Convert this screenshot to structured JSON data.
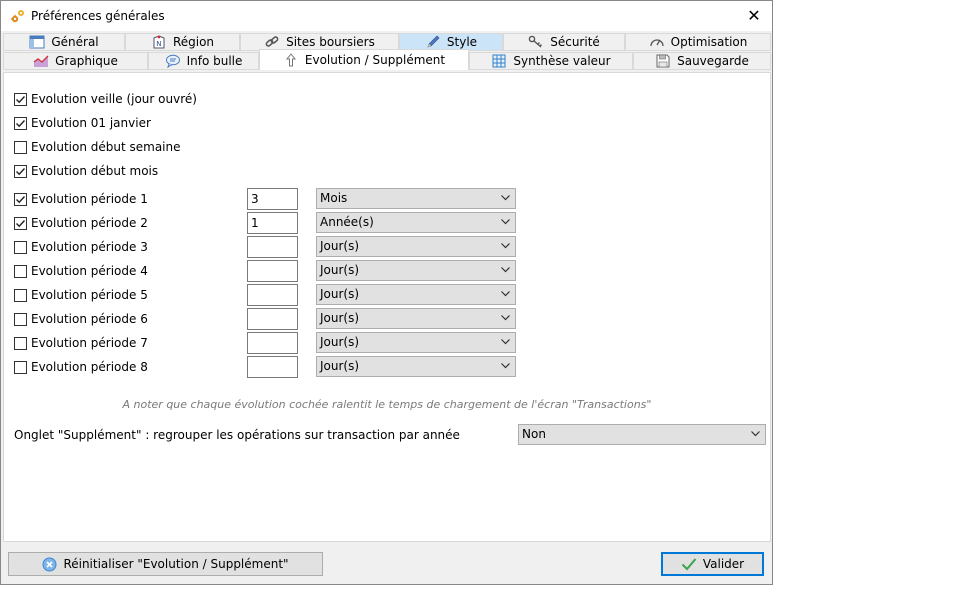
{
  "window": {
    "title": "Préférences générales",
    "close_label": "✕"
  },
  "tabs_row1": [
    {
      "label": "Général",
      "icon": "window-icon"
    },
    {
      "label": "Région",
      "icon": "region-icon"
    },
    {
      "label": "Sites boursiers",
      "icon": "link-icon"
    },
    {
      "label": "Style",
      "icon": "pencil-icon"
    },
    {
      "label": "Sécurité",
      "icon": "key-icon"
    },
    {
      "label": "Optimisation",
      "icon": "gauge-icon"
    }
  ],
  "tabs_row2": [
    {
      "label": "Graphique",
      "icon": "chart-icon"
    },
    {
      "label": "Info bulle",
      "icon": "speech-bubble-icon"
    },
    {
      "label": "Evolution / Supplément",
      "icon": "arrow-up-icon"
    },
    {
      "label": "Synthèse valeur",
      "icon": "grid-icon"
    },
    {
      "label": "Sauvegarde",
      "icon": "floppy-icon"
    }
  ],
  "evolutions": [
    {
      "label": "Evolution veille (jour ouvré)",
      "checked": true
    },
    {
      "label": "Evolution 01 janvier",
      "checked": true
    },
    {
      "label": "Evolution début semaine",
      "checked": false
    },
    {
      "label": "Evolution début mois",
      "checked": true
    }
  ],
  "periods": [
    {
      "label": "Evolution période 1",
      "checked": true,
      "value": "3",
      "unit": "Mois"
    },
    {
      "label": "Evolution période 2",
      "checked": true,
      "value": "1",
      "unit": "Année(s)"
    },
    {
      "label": "Evolution période 3",
      "checked": false,
      "value": "",
      "unit": "Jour(s)"
    },
    {
      "label": "Evolution période 4",
      "checked": false,
      "value": "",
      "unit": "Jour(s)"
    },
    {
      "label": "Evolution période 5",
      "checked": false,
      "value": "",
      "unit": "Jour(s)"
    },
    {
      "label": "Evolution période 6",
      "checked": false,
      "value": "",
      "unit": "Jour(s)"
    },
    {
      "label": "Evolution période 7",
      "checked": false,
      "value": "",
      "unit": "Jour(s)"
    },
    {
      "label": "Evolution période 8",
      "checked": false,
      "value": "",
      "unit": "Jour(s)"
    }
  ],
  "note": "A noter que chaque évolution cochée ralentit le temps de chargement de l'écran \"Transactions\"",
  "onglet": {
    "label": "Onglet \"Supplément\" : regrouper les opérations sur transaction par année",
    "value": "Non"
  },
  "buttons": {
    "reset_label": "Réinitialiser \"Evolution / Supplément\"",
    "validate_label": "Valider"
  },
  "colors": {
    "accent": "#0078d7",
    "tab_highlight": "#cce4f7"
  }
}
